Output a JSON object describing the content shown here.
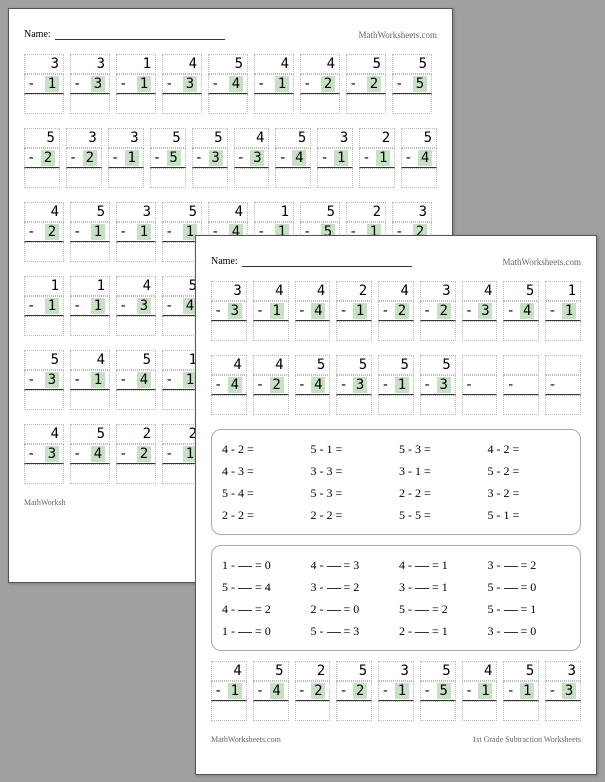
{
  "site": "MathWorksheets.com",
  "name_label": "Name:",
  "footer_left": "MathWorksh",
  "footer_right": "1st Grade Subtraction Worksheets",
  "back": {
    "rows": [
      [
        {
          "t": "3",
          "s": "1"
        },
        {
          "t": "3",
          "s": "3"
        },
        {
          "t": "1",
          "s": "1"
        },
        {
          "t": "4",
          "s": "3"
        },
        {
          "t": "5",
          "s": "4"
        },
        {
          "t": "4",
          "s": "1"
        },
        {
          "t": "4",
          "s": "2"
        },
        {
          "t": "5",
          "s": "2"
        },
        {
          "t": "5",
          "s": "5"
        }
      ],
      [
        {
          "t": "5",
          "s": "2"
        },
        {
          "t": "3",
          "s": "2"
        },
        {
          "t": "3",
          "s": "1"
        },
        {
          "t": "5",
          "s": "5"
        },
        {
          "t": "5",
          "s": "3"
        },
        {
          "t": "4",
          "s": "3"
        },
        {
          "t": "5",
          "s": "4"
        },
        {
          "t": "3",
          "s": "1"
        },
        {
          "t": "2",
          "s": "1"
        },
        {
          "t": "5",
          "s": "4"
        }
      ],
      [
        {
          "t": "4",
          "s": "2"
        },
        {
          "t": "5",
          "s": "1"
        },
        {
          "t": "3",
          "s": "1"
        },
        {
          "t": "5",
          "s": "1"
        },
        {
          "t": "4",
          "s": "4"
        },
        {
          "t": "1",
          "s": "1"
        },
        {
          "t": "5",
          "s": "5"
        },
        {
          "t": "2",
          "s": "1"
        },
        {
          "t": "3",
          "s": "2"
        }
      ],
      [
        {
          "t": "1",
          "s": "1"
        },
        {
          "t": "1",
          "s": "1"
        },
        {
          "t": "4",
          "s": "3"
        },
        {
          "t": "5",
          "s": "4"
        }
      ],
      [
        {
          "t": "5",
          "s": "3"
        },
        {
          "t": "4",
          "s": "1"
        },
        {
          "t": "5",
          "s": "4"
        },
        {
          "t": "1",
          "s": "1"
        }
      ],
      [
        {
          "t": "4",
          "s": "3"
        },
        {
          "t": "5",
          "s": "4"
        },
        {
          "t": "2",
          "s": "2"
        },
        {
          "t": "2",
          "s": "1"
        }
      ]
    ]
  },
  "front": {
    "rows": [
      [
        {
          "t": "3",
          "s": "3"
        },
        {
          "t": "4",
          "s": "1"
        },
        {
          "t": "4",
          "s": "4"
        },
        {
          "t": "2",
          "s": "1"
        },
        {
          "t": "4",
          "s": "2"
        },
        {
          "t": "3",
          "s": "2"
        },
        {
          "t": "4",
          "s": "3"
        },
        {
          "t": "5",
          "s": "4"
        },
        {
          "t": "1",
          "s": "1"
        }
      ],
      [
        {
          "t": "4",
          "s": "4"
        },
        {
          "t": "4",
          "s": "2"
        },
        {
          "t": "5",
          "s": "4"
        },
        {
          "t": "5",
          "s": "3"
        },
        {
          "t": "5",
          "s": "1"
        },
        {
          "t": "5",
          "s": "3"
        },
        {
          "t": "",
          "s": ""
        },
        {
          "t": "",
          "s": ""
        },
        {
          "t": "",
          "s": ""
        }
      ]
    ],
    "rowsBottom": [
      [
        {
          "t": "4",
          "s": "1"
        },
        {
          "t": "5",
          "s": "4"
        },
        {
          "t": "2",
          "s": "2"
        },
        {
          "t": "5",
          "s": "2"
        },
        {
          "t": "3",
          "s": "1"
        },
        {
          "t": "5",
          "s": "5"
        },
        {
          "t": "4",
          "s": "1"
        },
        {
          "t": "5",
          "s": "1"
        },
        {
          "t": "3",
          "s": "3"
        }
      ]
    ],
    "eq1": [
      "4 - 2 =",
      "5 - 1 =",
      "5 - 3 =",
      "4 - 2 =",
      "4 - 3 =",
      "3 - 3 =",
      "3 - 1 =",
      "5 - 2 =",
      "5 - 4 =",
      "5 - 3 =",
      "2 - 2 =",
      "3 - 2 =",
      "2 - 2 =",
      "2 - 2 =",
      "5 - 5 =",
      "5 - 1 ="
    ],
    "eq2": [
      {
        "a": "1",
        "r": "0"
      },
      {
        "a": "4",
        "r": "3"
      },
      {
        "a": "4",
        "r": "1"
      },
      {
        "a": "3",
        "r": "2"
      },
      {
        "a": "5",
        "r": "4"
      },
      {
        "a": "3",
        "r": "2"
      },
      {
        "a": "3",
        "r": "1"
      },
      {
        "a": "5",
        "r": "0"
      },
      {
        "a": "4",
        "r": "2"
      },
      {
        "a": "2",
        "r": "0"
      },
      {
        "a": "5",
        "r": "2"
      },
      {
        "a": "5",
        "r": "1"
      },
      {
        "a": "1",
        "r": "0"
      },
      {
        "a": "5",
        "r": "3"
      },
      {
        "a": "2",
        "r": "1"
      },
      {
        "a": "3",
        "r": "0"
      }
    ]
  }
}
